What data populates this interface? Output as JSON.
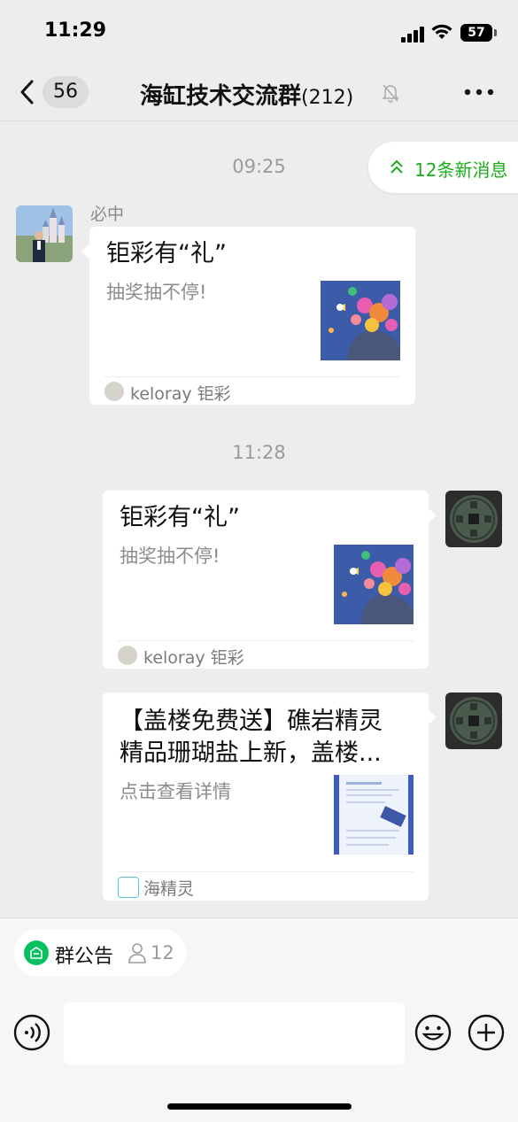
{
  "status_bar": {
    "time": "11:29",
    "battery": "57"
  },
  "nav": {
    "unread_count": "56",
    "title": "海缸技术交流群",
    "member_count": "(212)"
  },
  "new_messages": {
    "label": "12条新消息"
  },
  "messages": [
    {
      "type": "timestamp",
      "text": "09:25"
    },
    {
      "type": "card",
      "side": "left",
      "sender": "必中",
      "title": "钜彩有“礼”",
      "desc": "抽奖抽不停!",
      "source": "keloray 钜彩"
    },
    {
      "type": "timestamp",
      "text": "11:28"
    },
    {
      "type": "card",
      "side": "right",
      "title": "钜彩有“礼”",
      "desc": "抽奖抽不停!",
      "source": "keloray 钜彩"
    },
    {
      "type": "card",
      "side": "right",
      "title_line1": "【盖楼免费送】礁岩精灵",
      "title_line2": "精品珊瑚盐上新，盖楼...",
      "desc": "点击查看详情",
      "source": "海精灵"
    }
  ],
  "announcement": {
    "label": "群公告",
    "count": "12"
  },
  "colors": {
    "accent_green": "#07c160",
    "new_msg_green": "#1aad19",
    "chat_bg": "#ededed"
  },
  "icons": [
    "back-chevron-icon",
    "mute-bell-icon",
    "more-dots-icon",
    "double-up-arrow-icon",
    "announcement-icon",
    "person-icon",
    "voice-icon",
    "emoji-icon",
    "plus-icon"
  ]
}
